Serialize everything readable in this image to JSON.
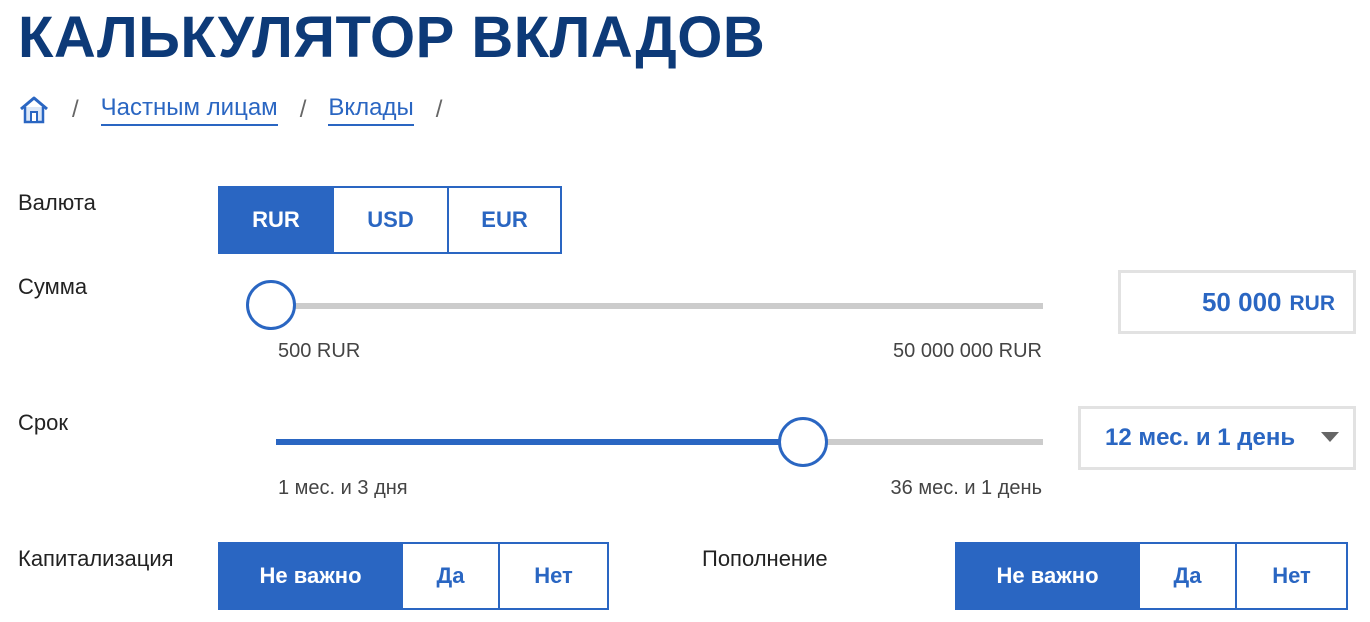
{
  "page": {
    "title": "КАЛЬКУЛЯТОР ВКЛАДОВ"
  },
  "breadcrumb": {
    "home_icon": "home-icon",
    "separator": "/",
    "items": [
      {
        "label": "Частным лицам"
      },
      {
        "label": "Вклады"
      }
    ]
  },
  "currency": {
    "label": "Валюта",
    "options": [
      "RUR",
      "USD",
      "EUR"
    ],
    "selected": "RUR"
  },
  "amount": {
    "label": "Сумма",
    "min_label": "500 RUR",
    "max_label": "50 000 000 RUR",
    "value": "50 000",
    "currency": "RUR"
  },
  "term": {
    "label": "Срок",
    "min_label": "1 мес. и 3 дня",
    "max_label": "36 мес. и 1 день",
    "selected": "12 мес. и 1 день",
    "caret_icon": "caret-down-icon"
  },
  "capitalization": {
    "label": "Капитализация",
    "options": [
      "Не важно",
      "Да",
      "Нет"
    ],
    "selected": "Не важно"
  },
  "replenishment": {
    "label": "Пополнение",
    "options": [
      "Не важно",
      "Да",
      "Нет"
    ],
    "selected": "Не важно"
  },
  "colors": {
    "accent": "#2a66c2",
    "title": "#0d3a78",
    "track": "#cccccc",
    "box_border": "#e2e2e2"
  }
}
